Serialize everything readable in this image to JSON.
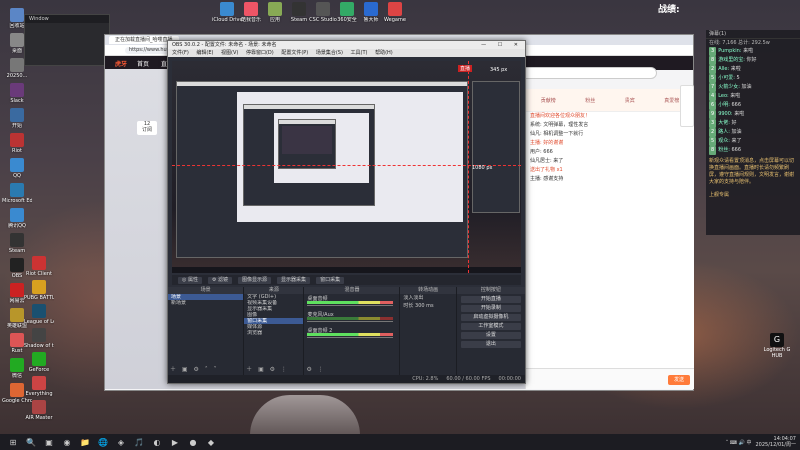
{
  "desktop_icons": [
    {
      "label": "回收站",
      "color": "#5b86c6",
      "glyph": "🗑"
    },
    {
      "label": "桌面",
      "color": "#888"
    },
    {
      "label": "20250...",
      "color": "#777"
    },
    {
      "label": "Slack",
      "color": "#6a3a7a"
    },
    {
      "label": "开始",
      "color": "#3a6aa0"
    },
    {
      "label": "Riot",
      "color": "#b33"
    },
    {
      "label": "QQ",
      "color": "#3a8ad0"
    },
    {
      "label": "Microsoft Edge",
      "color": "#2a7ab0"
    },
    {
      "label": "腾讯QQ",
      "color": "#3a8ad0"
    },
    {
      "label": "Steam",
      "color": "#333"
    },
    {
      "label": "OBS",
      "color": "#222"
    },
    {
      "label": "网易云",
      "color": "#c22"
    },
    {
      "label": "英雄联盟",
      "color": "#b8962a"
    },
    {
      "label": "Rust",
      "color": "#d55"
    },
    {
      "label": "微信",
      "color": "#2a2"
    },
    {
      "label": "Google Chrome",
      "color": "#d63"
    },
    {
      "label": "Riot Client",
      "color": "#c33"
    },
    {
      "label": "PUBG BATTLEGR...",
      "color": "#d8a020"
    },
    {
      "label": "League of Legends",
      "color": "#1a5070"
    },
    {
      "label": "Shadow of the Tomb...",
      "color": "#444"
    },
    {
      "label": "GeForce",
      "color": "#2a2"
    },
    {
      "label": "Everything",
      "color": "#c44"
    },
    {
      "label": "AIR Master",
      "color": "#a44"
    }
  ],
  "top_icons": [
    {
      "label": "iCloud Drive",
      "color": "#3a8ad0"
    },
    {
      "label": "酷我音乐",
      "color": "#e56"
    },
    {
      "label": "应用",
      "color": "#8a5"
    },
    {
      "label": "Steam",
      "color": "#333"
    },
    {
      "label": "CSC Studio",
      "color": "#555"
    },
    {
      "label": "360安全",
      "color": "#3a6"
    },
    {
      "label": "鲁大师",
      "color": "#2a6ad0"
    },
    {
      "label": "Wegame",
      "color": "#d44"
    }
  ],
  "browser": {
    "tab_label": "正在加载直播间_哈喽直播",
    "url": "https://www.huya.com/ ...",
    "site_logo": "虎牙",
    "nav": [
      "首页",
      "直播",
      "分类",
      "视频",
      "赛事"
    ],
    "fans_count": "12",
    "fans_label": "订阅",
    "chat_header": [
      "贡献榜",
      "粉丝",
      "贵宾",
      "真爱榜"
    ],
    "chat_messages": [
      "直播间欢迎各位观众朋友！",
      "系统: 文明弹幕，理性发言",
      "仙凡: 相机调整一下就行",
      "主播: 好的谢谢",
      "用户: 666",
      "仙凡居士: 来了",
      "送出了礼物 x1",
      "主播: 感谢支持"
    ],
    "send_label": "发送"
  },
  "obs": {
    "title": "OBS 30.0.2 - 配置文件: 未命名 - 场景: 未命名",
    "menu": [
      "文件(F)",
      "编辑(E)",
      "视图(V)",
      "停靠窗口(D)",
      "配置文件(P)",
      "场景集合(S)",
      "工具(T)",
      "帮助(H)"
    ],
    "preview_size_tag": "345 px",
    "preview_px_tag": "1080 px",
    "red_tag": "直播",
    "ctrl_buttons": [
      "◎ 属性",
      "⚙ 滤镜",
      "图像显示源",
      "显示器采集",
      "窗口采集"
    ],
    "docks": {
      "scenes": {
        "header": "场景",
        "items": [
          "场景",
          "新场景"
        ],
        "selected": 0
      },
      "sources": {
        "header": "来源",
        "items": [
          "文字 (GDI+)",
          "视频采集设备",
          "显示器采集",
          "图像",
          "窗口采集",
          "媒体源",
          "浏览器"
        ],
        "selected": 4
      },
      "mixer": {
        "header": "混音器",
        "rows": [
          {
            "name": "桌面音频",
            "db": "0.0 dB"
          },
          {
            "name": "麦克风/Aux",
            "db": "0.0 dB"
          },
          {
            "name": "桌面音频 2",
            "db": "0.0 dB"
          }
        ]
      },
      "transitions": {
        "header": "转场动画",
        "rows": [
          {
            "label": "淡入淡出"
          },
          {
            "label": "时长",
            "value": "300 ms"
          }
        ]
      },
      "controls": {
        "header": "控制按钮",
        "buttons": [
          "开始直播",
          "开始录制",
          "启动虚拟摄像机",
          "工作室模式",
          "设置",
          "退出"
        ]
      }
    },
    "status": [
      "CPU: 2.8%",
      "60.00 / 60.00 FPS",
      "00:00:00"
    ]
  },
  "right_chat": {
    "top_left": "弹幕(1)",
    "stats": "在线: 7,166   总计: 292.5w",
    "messages": [
      {
        "badge": "3",
        "name": "Pumpkin",
        "text": "来啦"
      },
      {
        "badge": "8",
        "name": "游戏里的宝",
        "text": "你好"
      },
      {
        "badge": "2",
        "name": "Alle",
        "text": "来啦"
      },
      {
        "badge": "5",
        "name": "小可爱",
        "text": "5"
      },
      {
        "badge": "7",
        "name": "火箭少女",
        "text": "加油"
      },
      {
        "badge": "4",
        "name": "Leo",
        "text": "来啦"
      },
      {
        "badge": "6",
        "name": "小明",
        "text": "666"
      },
      {
        "badge": "9",
        "name": "9900",
        "text": "来啦"
      },
      {
        "badge": "3",
        "name": "大佬",
        "text": "好"
      },
      {
        "badge": "2",
        "name": "路人",
        "text": "加油"
      },
      {
        "badge": "5",
        "name": "观众",
        "text": "来了"
      },
      {
        "badge": "8",
        "name": "粉丝",
        "text": "666"
      }
    ],
    "paragraph": "新观众请看置顶消息，点击屏幕可以切换直播间画面。直播时长请勿频繁刷屏，遵守直播间规则，文明发言，谢谢大家的支持与陪伴。",
    "footer": "上舰专属"
  },
  "overlay": {
    "battle_label": "战绩:"
  },
  "logitech": {
    "label": "Logitech G HUB"
  },
  "clock": {
    "time": "14:04:07",
    "date": "2025/12/01/周一"
  },
  "taskbar_apps": [
    "⊞",
    "🔍",
    "▣",
    "◉",
    "📁",
    "🌐",
    "◈",
    "🎵",
    "◐",
    "▶",
    "●",
    "◆"
  ]
}
